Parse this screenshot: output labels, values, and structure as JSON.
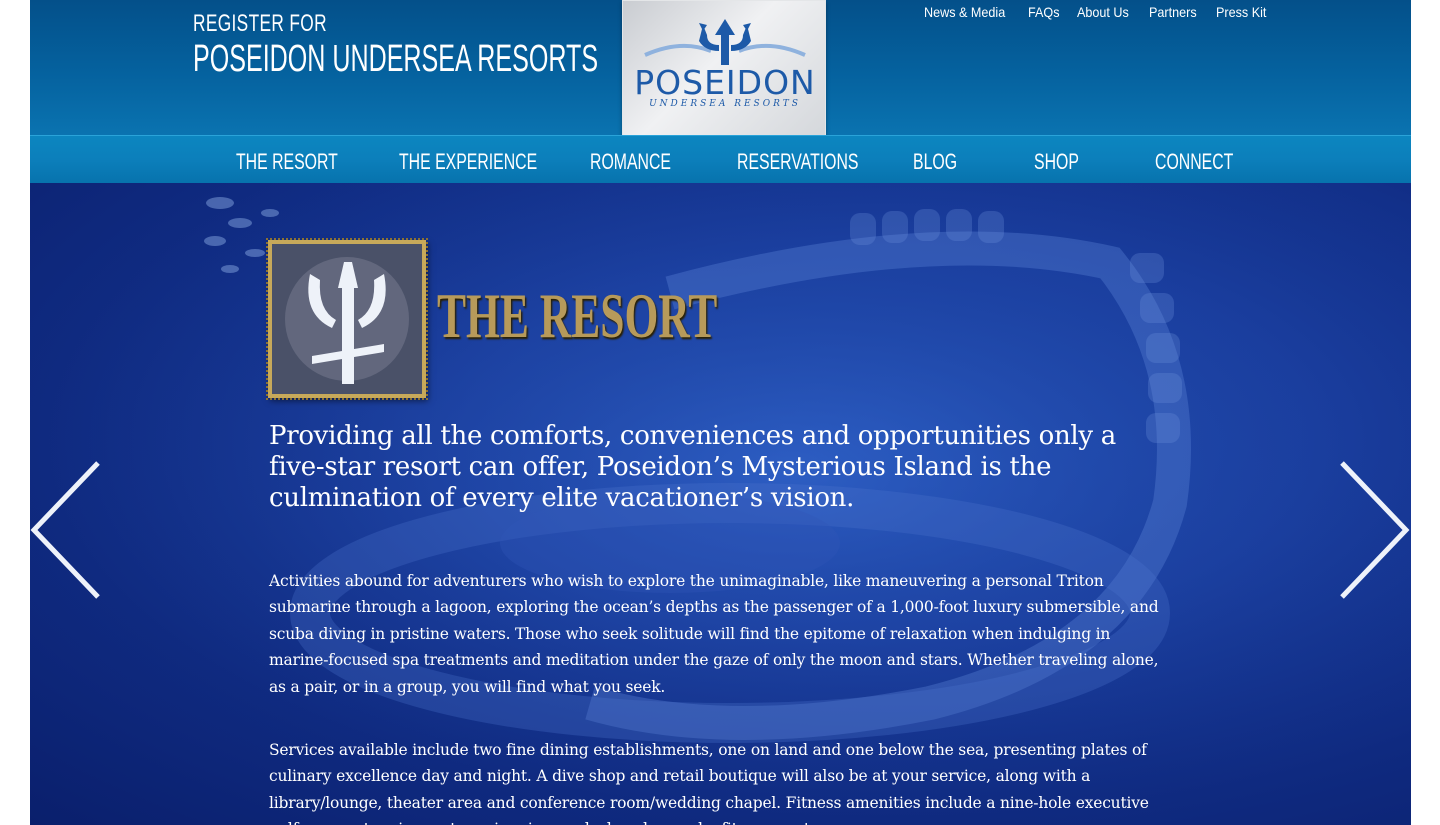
{
  "header": {
    "register_line1": "REGISTER FOR",
    "register_line2": "POSEIDON UNDERSEA RESORTS",
    "logo_word": "POSEIDON",
    "logo_sub": "UNDERSEA RESORTS",
    "utility_links": [
      "News & Media",
      "FAQs",
      "About Us",
      "Partners",
      "Press Kit"
    ]
  },
  "nav": {
    "items": [
      "THE RESORT",
      "THE EXPERIENCE",
      "ROMANCE",
      "RESERVATIONS",
      "BLOG",
      "SHOP",
      "CONNECT"
    ]
  },
  "hero": {
    "title": "THE RESORT",
    "lead": "Providing all the comforts, conveniences and opportunities only a five-star resort can offer, Poseidon’s Mysterious Island is the culmination of every elite vacationer’s vision.",
    "paragraph1": "Activities abound for adventurers who wish to explore the unimaginable, like maneuvering a personal Triton submarine through a lagoon, exploring the ocean’s depths as the passenger of a 1,000-foot luxury submersible, and scuba diving in pristine waters. Those who seek solitude will find the epitome of relaxation when indulging in marine-focused spa treatments and meditation under the gaze of only the moon and stars. Whether traveling alone, as a pair, or in a group, you will find what you seek.",
    "paragraph2": "Services available include two fine dining establishments, one on land and one below the sea, presenting plates of culinary excellence day and night. A dive shop and retail boutique will also be at your service, along with a library/lounge, theater area and conference room/wedding chapel. Fitness amenities include a nine-hole executive golf course, tennis courts, swimming pools, beaches and a fitness center."
  },
  "colors": {
    "header_blue": "#05629f",
    "nav_blue": "#0c7fbb",
    "hero_blue": "#1a3fa2",
    "title_gold": "#b79a5a"
  },
  "icons": [
    "trident-logo-icon",
    "trident-badge-icon",
    "chevron-left-icon",
    "chevron-right-icon"
  ]
}
